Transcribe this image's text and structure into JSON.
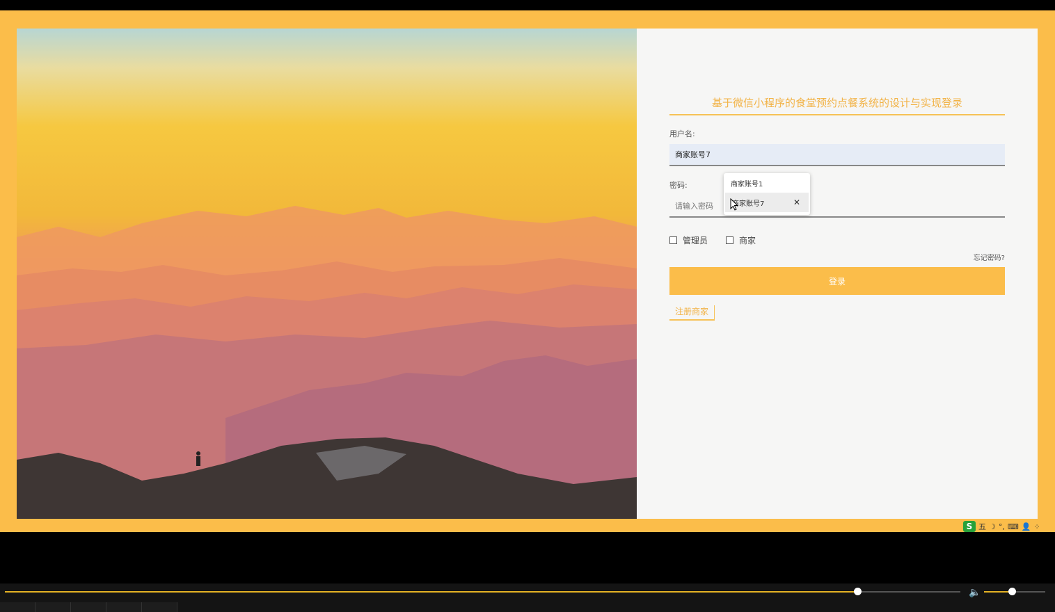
{
  "login": {
    "title": "基于微信小程序的食堂预约点餐系统的设计与实现登录",
    "username_label": "用户名:",
    "username_value": "商家账号7",
    "password_label": "密码:",
    "password_placeholder": "请输入密码",
    "role_admin": "管理员",
    "role_merchant": "商家",
    "forgot": "忘记密码?",
    "login_button": "登录",
    "register": "注册商家"
  },
  "autocomplete": {
    "items": [
      "商家账号1",
      "商家账号7"
    ],
    "remove_glyph": "✕"
  },
  "tray": {
    "ime_logo": "S",
    "ime_mode": "五",
    "moon": "☽",
    "punct": "°,",
    "keyboard": "⌨",
    "user": "👤",
    "apps": "⁘"
  },
  "player": {
    "progress_fraction": 0.892,
    "volume_fraction": 0.45,
    "volume_icon": "🔈"
  },
  "colors": {
    "accent": "#fbbd4a",
    "title_text": "#f2b347"
  }
}
